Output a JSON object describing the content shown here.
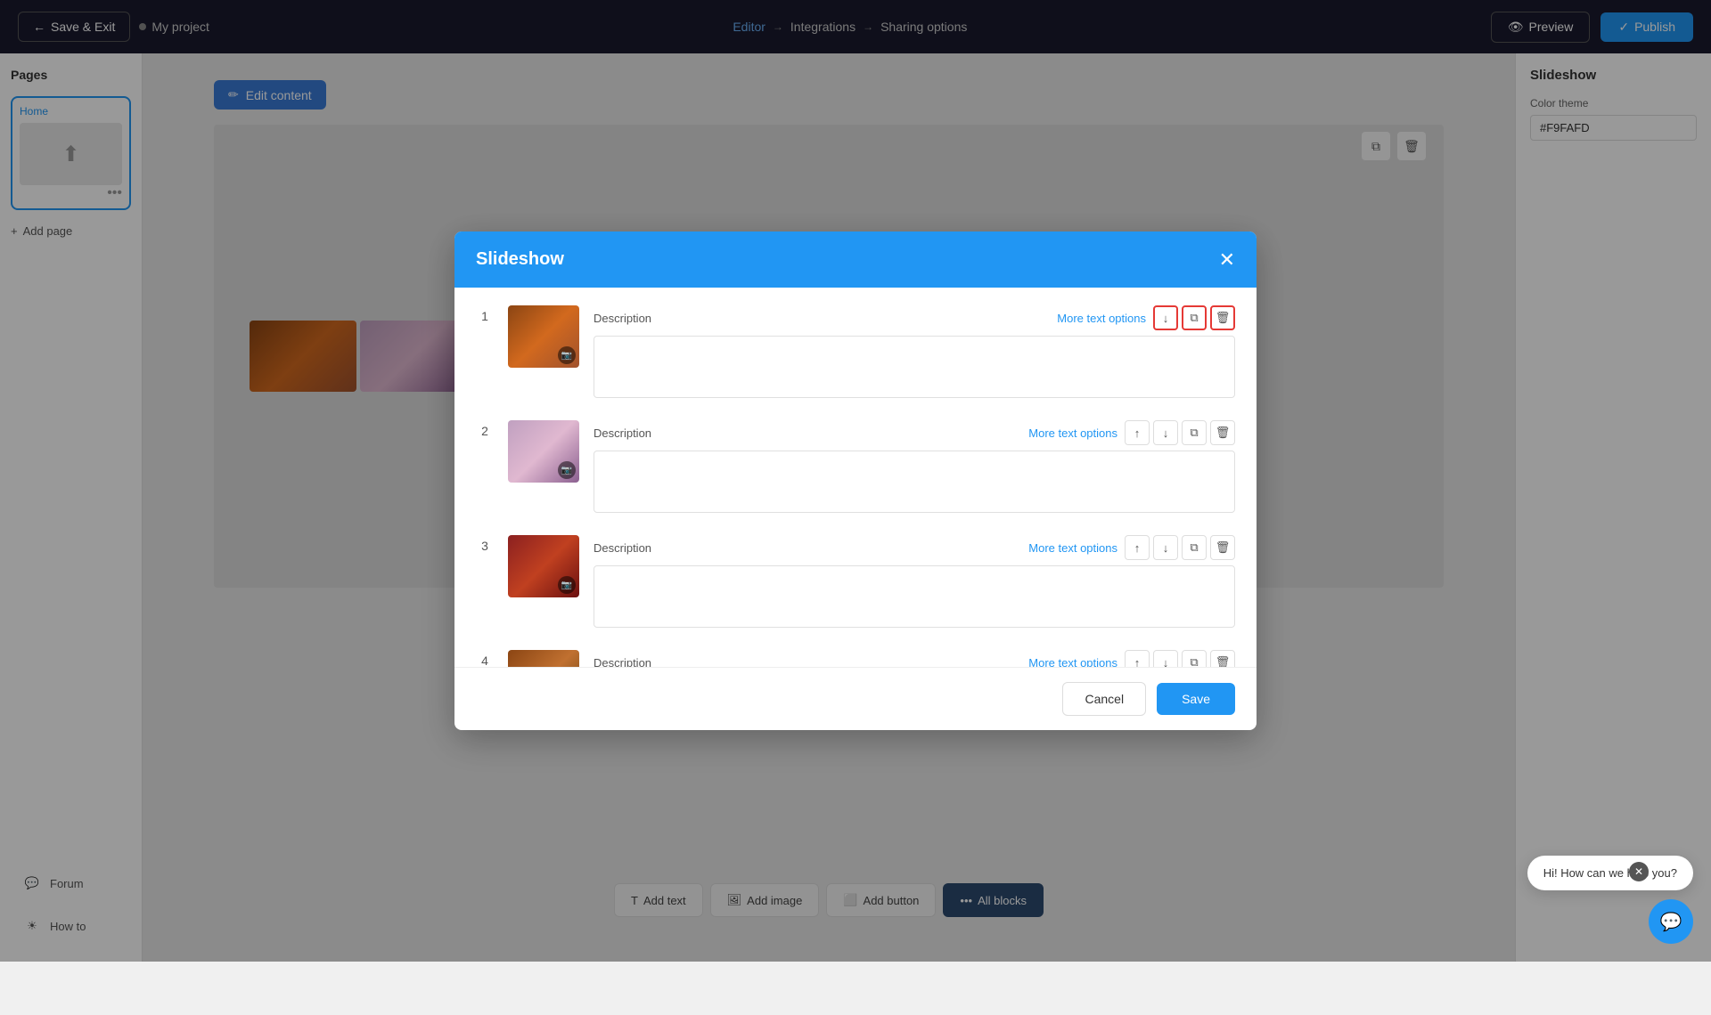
{
  "nav": {
    "save_exit_label": "Save & Exit",
    "project_name": "My project",
    "editor_label": "Editor",
    "integrations_label": "Integrations",
    "sharing_label": "Sharing options",
    "preview_label": "Preview",
    "publish_label": "Publish"
  },
  "pages_panel": {
    "title": "Pages",
    "home_label": "Home",
    "add_page_label": "Add page"
  },
  "slideshow_panel": {
    "title": "Slideshow",
    "color_theme_label": "Color theme",
    "color_value": "#F9FAFD"
  },
  "editor": {
    "edit_content_label": "Edit content"
  },
  "bottom_toolbar": {
    "add_text_label": "Add text",
    "add_image_label": "Add image",
    "add_button_label": "Add button",
    "all_blocks_label": "All blocks"
  },
  "bottom_nav": {
    "forum_label": "Forum",
    "howto_label": "How to"
  },
  "modal": {
    "title": "Slideshow",
    "slides": [
      {
        "number": "1",
        "description_label": "Description",
        "more_text_options": "More text options",
        "content": "",
        "highlighted": true
      },
      {
        "number": "2",
        "description_label": "Description",
        "more_text_options": "More text options",
        "content": "",
        "highlighted": false
      },
      {
        "number": "3",
        "description_label": "Description",
        "more_text_options": "More text options",
        "content": "",
        "highlighted": false
      },
      {
        "number": "4",
        "description_label": "Description",
        "more_text_options": "More text options",
        "content": "",
        "highlighted": false
      }
    ],
    "cancel_label": "Cancel",
    "save_label": "Save"
  },
  "chat": {
    "tooltip": "Hi! How can we help you?"
  }
}
